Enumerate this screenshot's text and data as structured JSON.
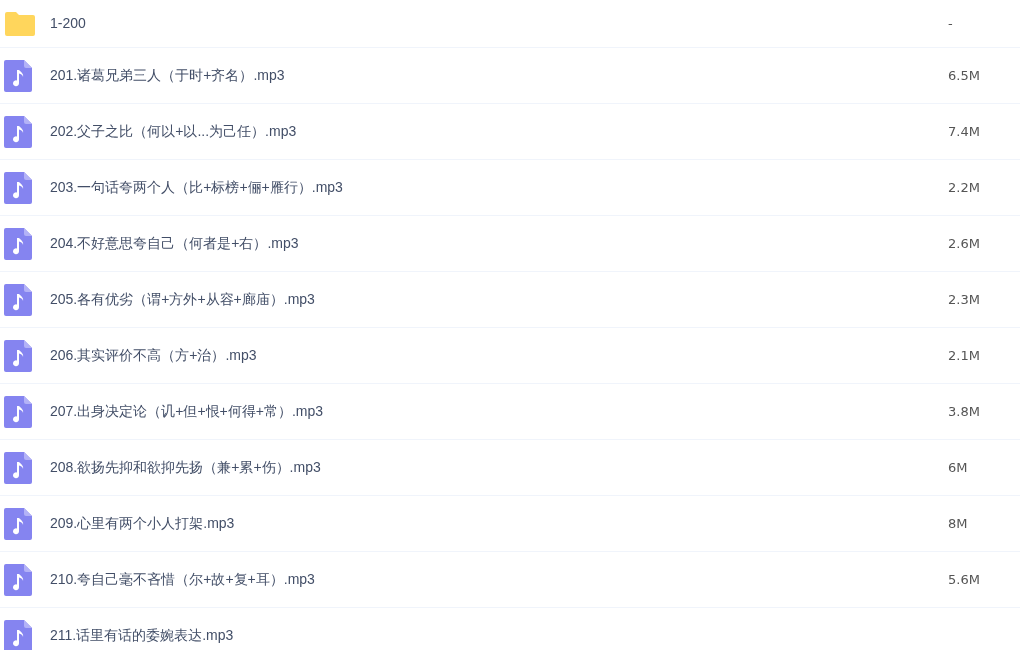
{
  "files": [
    {
      "kind": "folder",
      "name": "1-200",
      "size": "-"
    },
    {
      "kind": "audio",
      "name": "201.诸葛兄弟三人（于时+齐名）.mp3",
      "size": "6.5M"
    },
    {
      "kind": "audio",
      "name": "202.父子之比（何以+以...为己任）.mp3",
      "size": "7.4M"
    },
    {
      "kind": "audio",
      "name": "203.一句话夸两个人（比+标榜+俪+雁行）.mp3",
      "size": "2.2M"
    },
    {
      "kind": "audio",
      "name": "204.不好意思夸自己（何者是+右）.mp3",
      "size": "2.6M"
    },
    {
      "kind": "audio",
      "name": "205.各有优劣（谓+方外+从容+廊庙）.mp3",
      "size": "2.3M"
    },
    {
      "kind": "audio",
      "name": "206.其实评价不高（方+治）.mp3",
      "size": "2.1M"
    },
    {
      "kind": "audio",
      "name": "207.出身决定论（讥+但+恨+何得+常）.mp3",
      "size": "3.8M"
    },
    {
      "kind": "audio",
      "name": "208.欲扬先抑和欲抑先扬（兼+累+伤）.mp3",
      "size": "6M"
    },
    {
      "kind": "audio",
      "name": "209.心里有两个小人打架.mp3",
      "size": "8M"
    },
    {
      "kind": "audio",
      "name": "210.夸自己毫不吝惜（尔+故+复+耳）.mp3",
      "size": "5.6M"
    },
    {
      "kind": "audio",
      "name": "211.话里有话的委婉表达.mp3"
    }
  ]
}
